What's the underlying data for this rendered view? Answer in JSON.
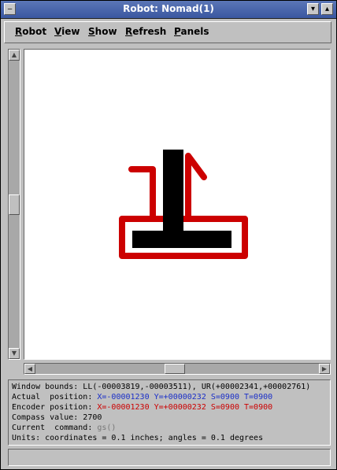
{
  "window": {
    "title": "Robot: Nomad(1)",
    "minimize_glyph": "▾",
    "maximize_glyph": "▴",
    "menu_glyph": "‒"
  },
  "menu": [
    "Robot",
    "View",
    "Show",
    "Refresh",
    "Panels"
  ],
  "scroll": {
    "up_glyph": "▲",
    "down_glyph": "▼",
    "left_glyph": "◀",
    "right_glyph": "▶"
  },
  "robot_colors": {
    "robot_body": "#000000",
    "trail": "#cc0000"
  },
  "status": {
    "window_bounds": "Window bounds: LL(-00003819,-00003511), UR(+00002341,+00002761)",
    "actual_label": "Actual  position: ",
    "actual_value": "X=-00001230 Y=+00000232 S=0900 T=0900",
    "encoder_label": "Encoder position: ",
    "encoder_value": "X=-00001230 Y=+00000232 S=0900 T=0900",
    "compass": "Compass value: 2700",
    "command_label": "Current  command: ",
    "command_value": "gs()",
    "units": "Units: coordinates = 0.1 inches; angles = 0.1 degrees"
  }
}
